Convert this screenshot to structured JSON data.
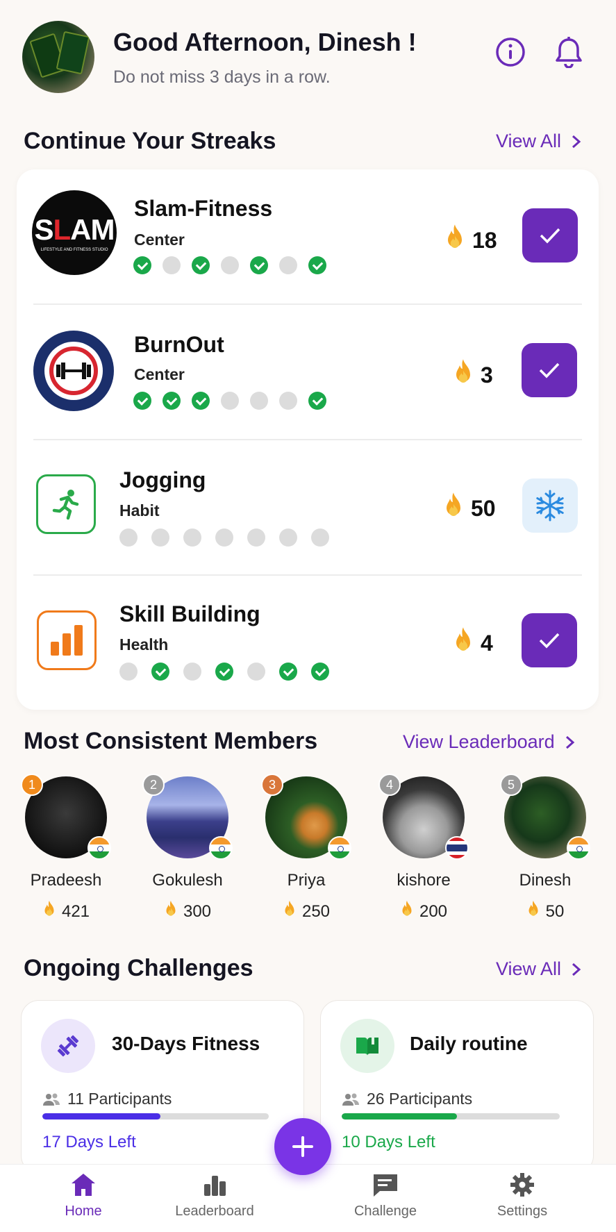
{
  "header": {
    "greeting": "Good Afternoon, Dinesh !",
    "subtitle": "Do not miss 3 days in a row."
  },
  "streaks_section": {
    "title": "Continue Your Streaks",
    "view_all": "View All",
    "items": [
      {
        "name": "Slam-Fitness",
        "type": "Center",
        "streak": "18",
        "days": [
          true,
          false,
          true,
          false,
          true,
          false,
          true
        ],
        "action": "check",
        "logo": "slam-logo"
      },
      {
        "name": "BurnOut",
        "type": "Center",
        "streak": "3",
        "days": [
          true,
          true,
          true,
          false,
          false,
          false,
          true
        ],
        "action": "check",
        "logo": "burnout-logo"
      },
      {
        "name": "Jogging",
        "type": "Habit",
        "streak": "50",
        "days": [
          false,
          false,
          false,
          false,
          false,
          false,
          false
        ],
        "action": "freeze",
        "logo": "running-icon"
      },
      {
        "name": "Skill Building",
        "type": "Health",
        "streak": "4",
        "days": [
          false,
          true,
          false,
          true,
          false,
          true,
          true
        ],
        "action": "check",
        "logo": "bar-chart-icon"
      }
    ]
  },
  "members_section": {
    "title": "Most Consistent Members",
    "view_leaderboard": "View Leaderboard",
    "members": [
      {
        "rank": "1",
        "name": "Pradeesh",
        "score": "421",
        "flag": "india",
        "rank_color": "#f08a1c"
      },
      {
        "rank": "2",
        "name": "Gokulesh",
        "score": "300",
        "flag": "india",
        "rank_color": "#9a9a9a"
      },
      {
        "rank": "3",
        "name": "Priya",
        "score": "250",
        "flag": "india",
        "rank_color": "#d9763a"
      },
      {
        "rank": "4",
        "name": "kishore",
        "score": "200",
        "flag": "thailand",
        "rank_color": "#9a9a9a"
      },
      {
        "rank": "5",
        "name": "Dinesh",
        "score": "50",
        "flag": "india",
        "rank_color": "#9a9a9a"
      }
    ]
  },
  "challenges_section": {
    "title": "Ongoing Challenges",
    "view_all": "View All",
    "challenges": [
      {
        "title": "30-Days Fitness",
        "participants": "11 Participants",
        "days_left": "17 Days Left",
        "progress": 0.52,
        "color": "#4a2ee6",
        "icon": "dumbbell-icon"
      },
      {
        "title": "Daily routine",
        "participants": "26 Participants",
        "days_left": "10 Days Left",
        "progress": 0.53,
        "color": "#1aa84a",
        "icon": "book-icon"
      }
    ]
  },
  "nav": {
    "items": [
      "Home",
      "Leaderboard",
      "Challenge",
      "Settings"
    ],
    "active": "Home"
  },
  "colors": {
    "accent": "#6a2bb8",
    "fab": "#7a34e6",
    "success": "#1aa84a"
  }
}
